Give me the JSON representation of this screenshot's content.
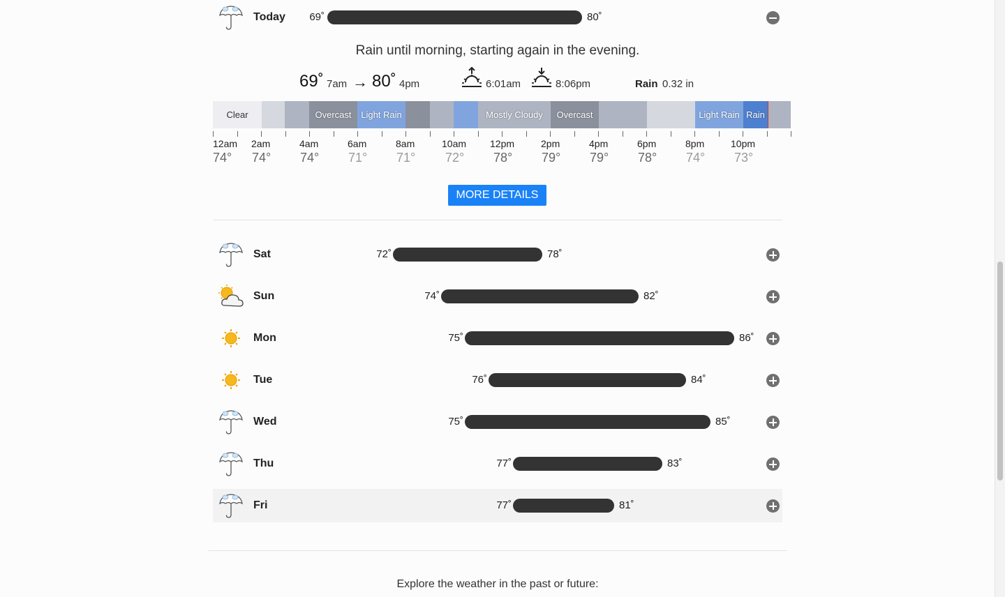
{
  "today": {
    "day": "Today",
    "icon": "rain-umbrella-icon",
    "low": "69˚",
    "high": "80˚",
    "summary": "Rain until morning, starting again in the evening.",
    "low_big": "69˚",
    "low_time": "7am",
    "arrow": "→",
    "high_big": "80˚",
    "high_time": "4pm",
    "sunrise": "6:01am",
    "sunset": "8:06pm",
    "precip_label": "Rain",
    "precip_value": "0.32 in"
  },
  "timeline": {
    "segments": [
      {
        "label": "Clear",
        "color": "#eeeef2"
      },
      {
        "label": "",
        "color": "#d5d8df"
      },
      {
        "label": "",
        "color": "#aeb4c1"
      },
      {
        "label": "Overcast",
        "color": "#8a909c"
      },
      {
        "label": "Light Rain",
        "color": "#80a5de"
      },
      {
        "label": "",
        "color": "#8a909c"
      },
      {
        "label": "",
        "color": "#aeb4c1"
      },
      {
        "label": "",
        "color": "#80a5de"
      },
      {
        "label": "Mostly Cloudy",
        "color": "#aeb4c1"
      },
      {
        "label": "Overcast",
        "color": "#8a909c"
      },
      {
        "label": "",
        "color": "#aeb4c1"
      },
      {
        "label": "",
        "color": "#d5d8df"
      },
      {
        "label": "Light Rain",
        "color": "#80a5de"
      },
      {
        "label": "Rain",
        "color": "#4d80cf"
      },
      {
        "label": "",
        "color": "#aeb4c1"
      }
    ],
    "hours": [
      {
        "label": "12am",
        "temp": "74°"
      },
      {
        "label": "2am",
        "temp": "74°"
      },
      {
        "label": "4am",
        "temp": "74°"
      },
      {
        "label": "6am",
        "temp": "71°"
      },
      {
        "label": "8am",
        "temp": "71°"
      },
      {
        "label": "10am",
        "temp": "72°"
      },
      {
        "label": "12pm",
        "temp": "78°"
      },
      {
        "label": "2pm",
        "temp": "79°"
      },
      {
        "label": "4pm",
        "temp": "79°"
      },
      {
        "label": "6pm",
        "temp": "78°"
      },
      {
        "label": "8pm",
        "temp": "74°"
      },
      {
        "label": "10pm",
        "temp": "73°"
      }
    ]
  },
  "more_details": "MORE DETAILS",
  "days": [
    {
      "day": "Sat",
      "icon": "rain-umbrella-icon",
      "low": "72˚",
      "high": "78˚"
    },
    {
      "day": "Sun",
      "icon": "partly-cloudy-icon",
      "low": "74˚",
      "high": "82˚"
    },
    {
      "day": "Mon",
      "icon": "sun-icon",
      "low": "75˚",
      "high": "86˚"
    },
    {
      "day": "Tue",
      "icon": "sun-icon",
      "low": "76˚",
      "high": "84˚"
    },
    {
      "day": "Wed",
      "icon": "rain-umbrella-icon",
      "low": "75˚",
      "high": "85˚"
    },
    {
      "day": "Thu",
      "icon": "rain-umbrella-icon",
      "low": "77˚",
      "high": "83˚"
    },
    {
      "day": "Fri",
      "icon": "rain-umbrella-icon",
      "low": "77˚",
      "high": "81˚"
    }
  ],
  "footer": "Explore the weather in the past or future:"
}
